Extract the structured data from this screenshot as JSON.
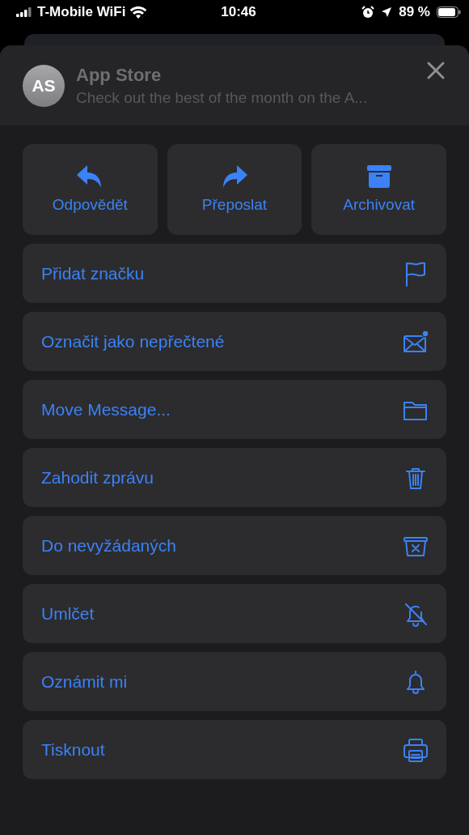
{
  "status_bar": {
    "carrier": "T-Mobile WiFi",
    "time": "10:46",
    "battery": "89 %"
  },
  "header": {
    "initials": "AS",
    "sender": "App Store",
    "preview": "Check out the best of the month on the A..."
  },
  "actions": [
    {
      "label": "Odpovědět",
      "kind": "reply"
    },
    {
      "label": "Přeposlat",
      "kind": "forward"
    },
    {
      "label": "Archivovat",
      "kind": "archive"
    }
  ],
  "menu": [
    {
      "label": "Přidat značku",
      "kind": "flag"
    },
    {
      "label": "Označit jako nepřečtené",
      "kind": "unread"
    },
    {
      "label": "Move Message...",
      "kind": "folder"
    },
    {
      "label": "Zahodit zprávu",
      "kind": "trash"
    },
    {
      "label": "Do nevyžádaných",
      "kind": "junk"
    },
    {
      "label": "Umlčet",
      "kind": "mute"
    },
    {
      "label": "Oznámit mi",
      "kind": "bell"
    },
    {
      "label": "Tisknout",
      "kind": "print"
    }
  ]
}
